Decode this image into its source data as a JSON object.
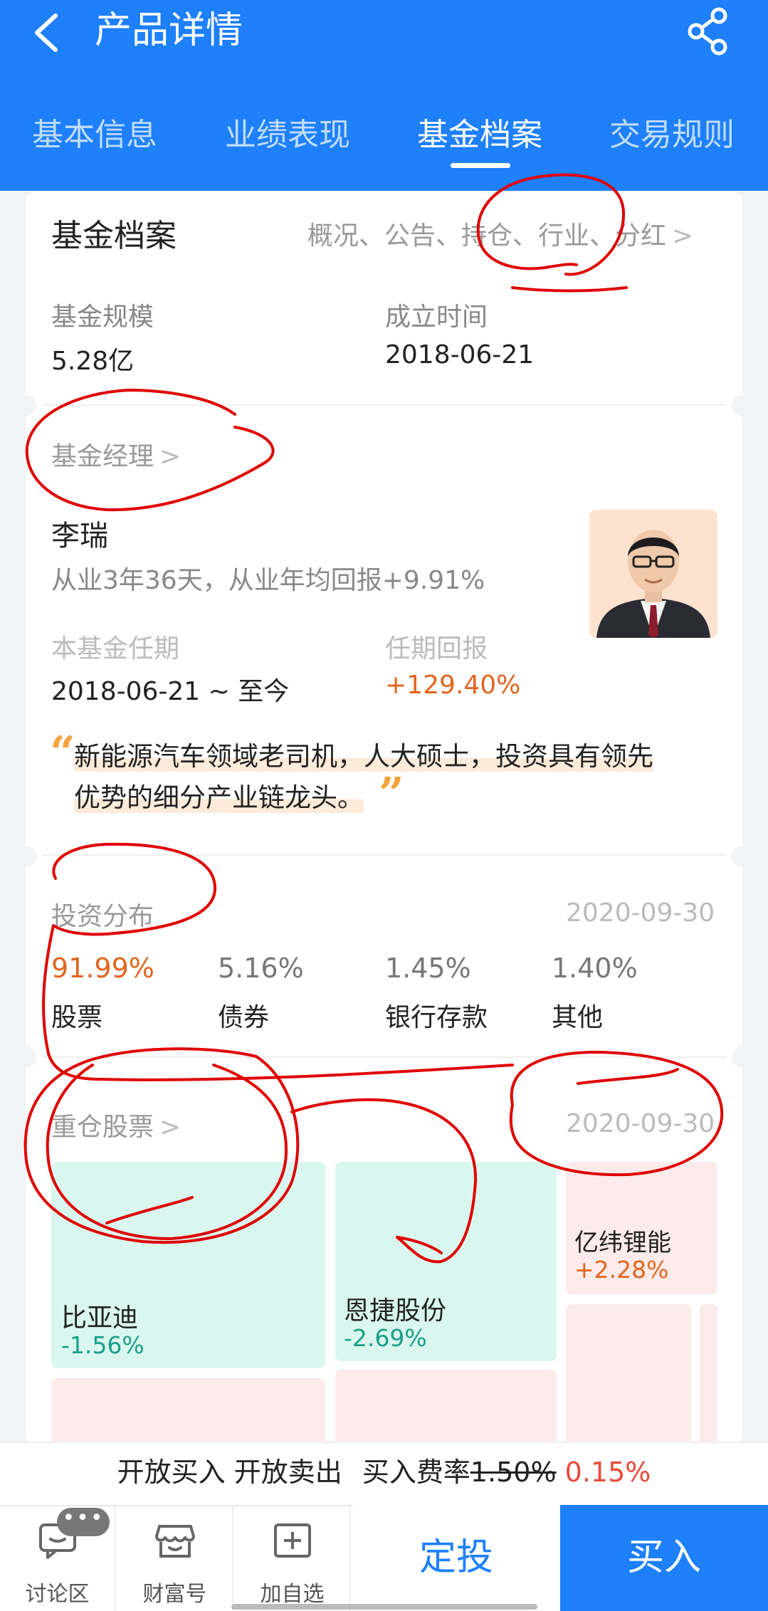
{
  "header": {
    "title": "产品详情",
    "tabs": [
      {
        "label": "基本信息"
      },
      {
        "label": "业绩表现"
      },
      {
        "label": "基金档案"
      },
      {
        "label": "交易规则"
      }
    ]
  },
  "archive": {
    "title": "基金档案",
    "links": "概况、公告、持仓、行业、分红",
    "scale_label": "基金规模",
    "scale_value": "5.28亿",
    "founded_label": "成立时间",
    "founded_value": "2018-06-21"
  },
  "manager": {
    "section_title": "基金经理",
    "name": "李瑞",
    "summary": "从业3年36天，从业年均回报+9.91%",
    "tenure_label": "本基金任期",
    "tenure_value": "2018-06-21 ~ 至今",
    "return_label": "任期回报",
    "return_value": "+129.40%",
    "quote_line1": "新能源汽车领域老司机，人大硕士，投资具有领先",
    "quote_line2": "优势的细分产业链龙头。"
  },
  "allocation": {
    "title": "投资分布",
    "date": "2020-09-30",
    "items": [
      {
        "value": "91.99%",
        "label": "股票"
      },
      {
        "value": "5.16%",
        "label": "债券"
      },
      {
        "value": "1.45%",
        "label": "银行存款"
      },
      {
        "value": "1.40%",
        "label": "其他"
      }
    ]
  },
  "holdings": {
    "title": "重仓股票",
    "date": "2020-09-30",
    "stocks": [
      {
        "name": "比亚迪",
        "change": "-1.56%"
      },
      {
        "name": "恩捷股份",
        "change": "-2.69%"
      },
      {
        "name": "亿纬锂能",
        "change": "+2.28%"
      }
    ]
  },
  "fee": {
    "status": "开放买入 开放卖出",
    "rate_label": "买入费率",
    "original_rate": "1.50%",
    "discount_rate": "0.15%"
  },
  "bottom_nav": {
    "items": [
      {
        "label": "讨论区",
        "icon": "chat-icon"
      },
      {
        "label": "财富号",
        "icon": "store-icon"
      },
      {
        "label": "加自选",
        "icon": "add-watchlist-icon"
      }
    ],
    "badge": "•••",
    "sip_label": "定投",
    "buy_label": "买入"
  },
  "colors": {
    "brand_blue": "#1e80fb",
    "up_orange": "#e2661e",
    "down_green": "#1b9e8a",
    "annotation_red": "#e00000"
  }
}
